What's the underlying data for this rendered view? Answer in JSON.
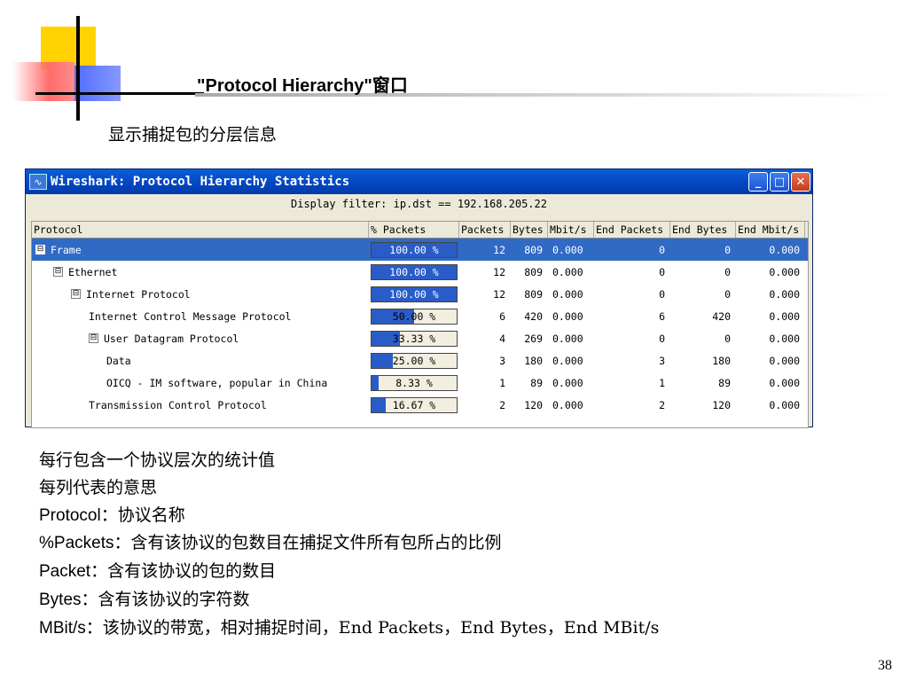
{
  "slide": {
    "title": "\"Protocol Hierarchy\"窗口",
    "subtitle": "显示捕捉包的分层信息",
    "page_number": "38"
  },
  "window": {
    "title": "Wireshark: Protocol Hierarchy Statistics",
    "display_filter": "Display filter: ip.dst == 192.168.205.22",
    "controls": {
      "minimize": "_",
      "maximize": "□",
      "close": "✕"
    }
  },
  "table": {
    "columns": [
      "Protocol",
      "% Packets",
      "Packets",
      "Bytes",
      "Mbit/s",
      "End Packets",
      "End Bytes",
      "End Mbit/s"
    ],
    "rows": [
      {
        "protocol": "Frame",
        "level": 0,
        "toggle": "⊟",
        "pct_label": "100.00 %",
        "pct": 100,
        "packets": "12",
        "bytes": "809",
        "mbit": "0.000",
        "end_packets": "0",
        "end_bytes": "0",
        "end_mbit": "0.000",
        "selected": true
      },
      {
        "protocol": "Ethernet",
        "level": 1,
        "toggle": "⊟",
        "pct_label": "100.00 %",
        "pct": 100,
        "packets": "12",
        "bytes": "809",
        "mbit": "0.000",
        "end_packets": "0",
        "end_bytes": "0",
        "end_mbit": "0.000"
      },
      {
        "protocol": "Internet Protocol",
        "level": 2,
        "toggle": "⊟",
        "pct_label": "100.00 %",
        "pct": 100,
        "packets": "12",
        "bytes": "809",
        "mbit": "0.000",
        "end_packets": "0",
        "end_bytes": "0",
        "end_mbit": "0.000"
      },
      {
        "protocol": "Internet Control Message Protocol",
        "level": 3,
        "toggle": "",
        "pct_label": "50.00 %",
        "pct": 50,
        "packets": "6",
        "bytes": "420",
        "mbit": "0.000",
        "end_packets": "6",
        "end_bytes": "420",
        "end_mbit": "0.000"
      },
      {
        "protocol": "User Datagram Protocol",
        "level": 3,
        "toggle": "⊟",
        "pct_label": "33.33 %",
        "pct": 33.33,
        "packets": "4",
        "bytes": "269",
        "mbit": "0.000",
        "end_packets": "0",
        "end_bytes": "0",
        "end_mbit": "0.000"
      },
      {
        "protocol": "Data",
        "level": 4,
        "toggle": "",
        "pct_label": "25.00 %",
        "pct": 25,
        "packets": "3",
        "bytes": "180",
        "mbit": "0.000",
        "end_packets": "3",
        "end_bytes": "180",
        "end_mbit": "0.000"
      },
      {
        "protocol": "OICQ - IM software, popular in China",
        "level": 4,
        "toggle": "",
        "pct_label": "8.33 %",
        "pct": 8.33,
        "packets": "1",
        "bytes": "89",
        "mbit": "0.000",
        "end_packets": "1",
        "end_bytes": "89",
        "end_mbit": "0.000"
      },
      {
        "protocol": "Transmission Control Protocol",
        "level": 3,
        "toggle": "",
        "pct_label": "16.67 %",
        "pct": 16.67,
        "packets": "2",
        "bytes": "120",
        "mbit": "0.000",
        "end_packets": "2",
        "end_bytes": "120",
        "end_mbit": "0.000"
      }
    ]
  },
  "notes": [
    {
      "term": "",
      "text": "每行包含一个协议层次的统计值"
    },
    {
      "term": "",
      "text": "每列代表的意思"
    },
    {
      "term": "Protocol",
      "text": "：协议名称"
    },
    {
      "term": "%Packets",
      "text": "：含有该协议的包数目在捕捉文件所有包所占的比例"
    },
    {
      "term": "Packet",
      "text": "：含有该协议的包的数目"
    },
    {
      "term": "Bytes",
      "text": "：含有该协议的字符数"
    },
    {
      "term": "MBit/s",
      "text": "：该协议的带宽，相对捕捉时间，End Packets，End Bytes，End MBit/s"
    }
  ],
  "colors": {
    "selection": "#316ac5",
    "bar_fill": "#2a5cc8",
    "titlebar": "#0349c4"
  }
}
